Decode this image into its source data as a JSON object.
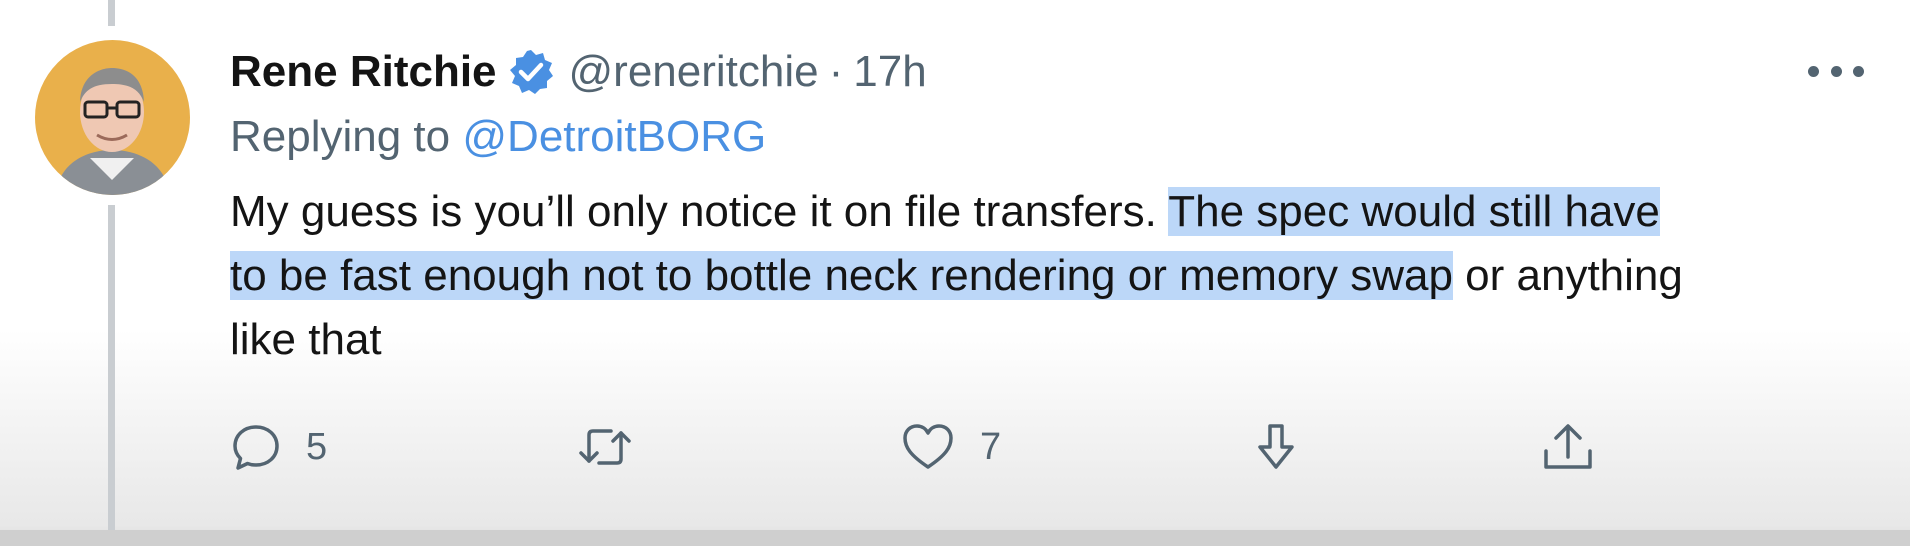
{
  "tweet": {
    "author_name": "Rene Ritchie",
    "handle": "@reneritchie",
    "separator": "·",
    "time": "17h",
    "replying_prefix": "Replying to",
    "replying_to": "@DetroitBORG",
    "text_line1_plain": "My guess is you’ll only notice it on file transfers. ",
    "text_line1_highlight": "The spec would still have",
    "text_line2_highlight": "to be fast enough not to bottle neck rendering or memory swap",
    "text_line2_plain": " or anything",
    "text_line3_plain": "like that",
    "replies": "5",
    "likes": "7"
  },
  "colors": {
    "highlight": "#bcd7f8",
    "mention": "#4a90e2",
    "muted": "#536471",
    "verified": "#4a90e2",
    "avatar_bg": "#e9b04b"
  },
  "icons": {
    "verified": "verified-badge-icon",
    "more": "more-dots-icon",
    "reply": "reply-bubble-icon",
    "retweet": "retweet-icon",
    "like": "heart-icon",
    "bookmark": "bookmark-arrow-icon",
    "share": "share-icon"
  }
}
